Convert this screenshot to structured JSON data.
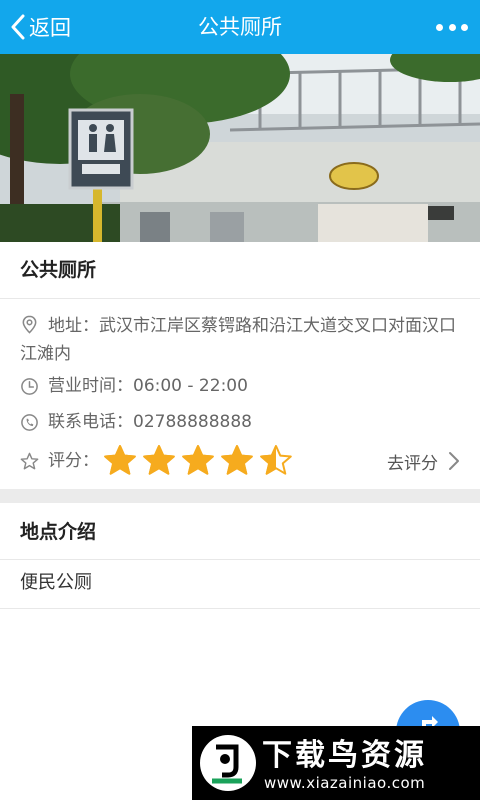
{
  "header": {
    "back_label": "返回",
    "title": "公共厕所"
  },
  "place": {
    "name": "公共厕所",
    "address": "地址：武汉市江岸区蔡锷路和沿江大道交叉口对面汉口江滩内",
    "hours": "营业时间：06:00 - 22:00",
    "phone": "联系电话：02788888888",
    "rating_label": "评分：",
    "rating_value": 4.5,
    "rating_max": 5,
    "rate_link": "去评分"
  },
  "intro": {
    "heading": "地点介绍",
    "body": "便民公厕"
  },
  "watermark": {
    "title": "下载鸟资源",
    "url": "www.xiazainiao.com"
  },
  "icons": {
    "back": "chevron-left-icon",
    "more": "more-dots-icon",
    "address": "location-pin-icon",
    "hours": "clock-icon",
    "phone": "phone-icon",
    "rating": "star-outline-icon",
    "rate_link": "chevron-right-icon",
    "fab": "route-navigation-icon"
  },
  "colors": {
    "header": "#12a7ec",
    "star": "#f6ab1e",
    "fab": "#2c8df0",
    "separator": "#ebebeb"
  }
}
